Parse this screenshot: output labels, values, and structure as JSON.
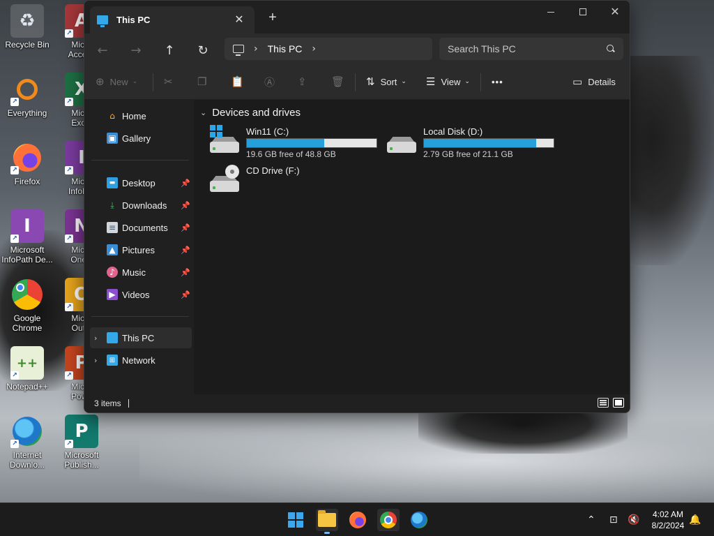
{
  "desktop": {
    "icons": [
      {
        "label": "Recycle Bin"
      },
      {
        "label": "Micro\nAccess"
      },
      {
        "label": "Everything"
      },
      {
        "label": "Micro\nExcel"
      },
      {
        "label": "Firefox"
      },
      {
        "label": "Micro\nInfoPat"
      },
      {
        "label": "Microsoft\nInfoPath De..."
      },
      {
        "label": "Micro\nOneN"
      },
      {
        "label": "Google\nChrome"
      },
      {
        "label": "Micro\nOutlo"
      },
      {
        "label": "Notepad++"
      },
      {
        "label": "Micro\nPowe"
      },
      {
        "label": "Internet\nDownlo..."
      },
      {
        "label": "Microsoft\nPublish..."
      }
    ]
  },
  "window": {
    "tab_title": "This PC",
    "tab_close": "✕",
    "new_tab": "+",
    "controls": {
      "close": "✕"
    }
  },
  "addressbar": {
    "back": "←",
    "forward": "→",
    "up": "↑",
    "refresh": "↻",
    "breadcrumb": "This PC",
    "chevron": "›",
    "search_placeholder": "Search This PC"
  },
  "commandbar": {
    "new_label": "New",
    "sort_label": "Sort",
    "view_label": "View",
    "more": "•••",
    "details_label": "Details"
  },
  "sidebar": {
    "items": [
      {
        "label": "Home",
        "icon": "home-icon"
      },
      {
        "label": "Gallery",
        "icon": "gallery-icon"
      },
      {
        "label": "Desktop",
        "icon": "desktop-icon",
        "pinned": true
      },
      {
        "label": "Downloads",
        "icon": "download-icon",
        "pinned": true
      },
      {
        "label": "Documents",
        "icon": "documents-icon",
        "pinned": true
      },
      {
        "label": "Pictures",
        "icon": "pictures-icon",
        "pinned": true
      },
      {
        "label": "Music",
        "icon": "music-icon",
        "pinned": true
      },
      {
        "label": "Videos",
        "icon": "videos-icon",
        "pinned": true
      },
      {
        "label": "This PC",
        "icon": "pc-icon",
        "selected": true
      },
      {
        "label": "Network",
        "icon": "network-icon"
      }
    ]
  },
  "main": {
    "section_title": "Devices and drives",
    "drives": [
      {
        "name": "Win11 (C:)",
        "free_text": "19.6 GB free of 48.8 GB",
        "used_fraction": 0.598
      },
      {
        "name": "Local Disk (D:)",
        "free_text": "2.79 GB free of 21.1 GB",
        "used_fraction": 0.868
      },
      {
        "name": "CD Drive (F:)"
      }
    ]
  },
  "status": {
    "item_count": "3 items"
  },
  "taskbar": {
    "clock_time": "4:02 AM",
    "clock_date": "8/2/2024",
    "tray_chevron": "⌃"
  },
  "colors": {
    "accent": "#26a0da",
    "window_bg": "#191919",
    "nav_bg": "#202020"
  }
}
